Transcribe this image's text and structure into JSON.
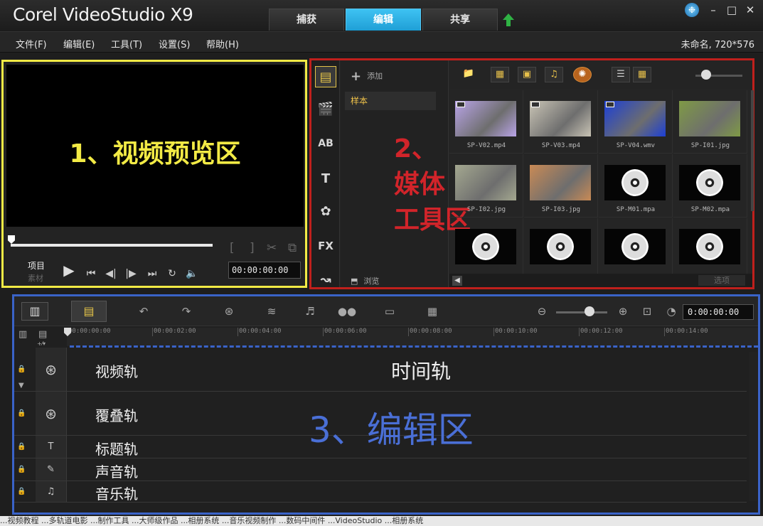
{
  "app": {
    "brand": "Corel VideoStudio X9"
  },
  "tabs": [
    {
      "label": "捕获"
    },
    {
      "label": "编辑"
    },
    {
      "label": "共享"
    }
  ],
  "window": {
    "minimize": "–",
    "maximize": "□",
    "close": "✕"
  },
  "menu": {
    "items": [
      {
        "label": "文件(F)"
      },
      {
        "label": "编辑(E)"
      },
      {
        "label": "工具(T)"
      },
      {
        "label": "设置(S)"
      },
      {
        "label": "帮助(H)"
      }
    ],
    "project_info": "未命名, 720*576"
  },
  "preview": {
    "annotation": "1、视频预览区",
    "mode_project": "项目",
    "mode_clip": "素材",
    "timecode": "00:00:00:00"
  },
  "library": {
    "annotation": "2、\n媒体\n工具区",
    "add_label": "添加",
    "folder": "样本",
    "browse_label": "浏览",
    "options_label": "选项",
    "icons": [
      "media-icon",
      "instant-project-icon",
      "transition-icon",
      "title-icon",
      "graphic-icon",
      "filter-icon",
      "path-icon"
    ],
    "thumbnails": [
      {
        "name": "SP-V02.mp4",
        "kind": "video",
        "color": "#b9a4e8"
      },
      {
        "name": "SP-V03.mp4",
        "kind": "video",
        "color": "#c9c4b5"
      },
      {
        "name": "SP-V04.wmv",
        "kind": "video",
        "color": "#1c3fd6"
      },
      {
        "name": "SP-I01.jpg",
        "kind": "image",
        "color": "#7f9a45"
      },
      {
        "name": "SP-I02.jpg",
        "kind": "image",
        "color": "#a4a890"
      },
      {
        "name": "SP-I03.jpg",
        "kind": "image",
        "color": "#c98a55"
      },
      {
        "name": "SP-M01.mpa",
        "kind": "audio",
        "color": "#050505"
      },
      {
        "name": "SP-M02.mpa",
        "kind": "audio",
        "color": "#050505"
      },
      {
        "name": "",
        "kind": "audio",
        "color": "#050505"
      },
      {
        "name": "",
        "kind": "audio",
        "color": "#050505"
      },
      {
        "name": "",
        "kind": "audio",
        "color": "#050505"
      },
      {
        "name": "",
        "kind": "audio",
        "color": "#050505"
      }
    ]
  },
  "timeline": {
    "timecode": "0:00:00:00",
    "ruler": [
      "00:00:00:00",
      "00:00:02:00",
      "00:00:04:00",
      "00:00:06:00",
      "00:00:08:00",
      "00:00:10:00",
      "00:00:12:00",
      "00:00:14:00"
    ],
    "time_track_label": "时间轨",
    "annotation": "3、编辑区",
    "tracks": [
      {
        "name": "视频轨",
        "icon": "film-reel-icon"
      },
      {
        "name": "覆叠轨",
        "icon": "overlay-reel-icon"
      },
      {
        "name": "标题轨",
        "icon": "title-track-icon"
      },
      {
        "name": "声音轨",
        "icon": "voice-track-icon"
      },
      {
        "name": "音乐轨",
        "icon": "music-track-icon"
      }
    ]
  },
  "taskbar": {
    "text": "...视频教程  ...多轨道电影  ...制作工具  ...大师级作品  ...相册系统  ...音乐视频制作  ...数码中间件  ...VideoStudio  ...相册系统"
  }
}
